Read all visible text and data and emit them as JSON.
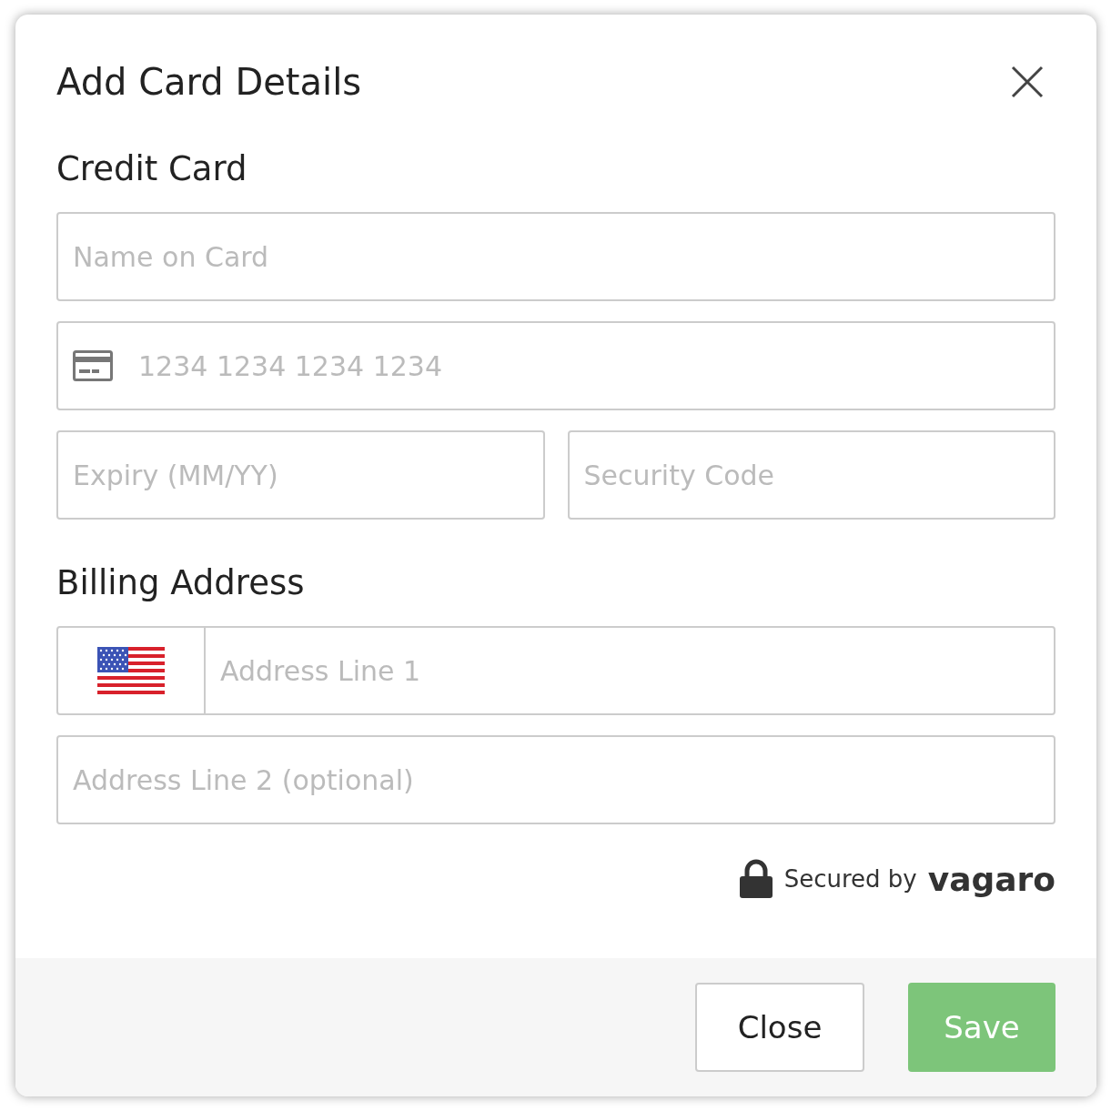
{
  "dialog": {
    "title": "Add Card Details"
  },
  "sections": [
    {
      "heading": "Credit Card",
      "rows": [
        [
          {
            "kind": "text",
            "placeholder": "Name on Card"
          }
        ],
        [
          {
            "kind": "card",
            "placeholder": "1234 1234 1234 1234"
          }
        ],
        [
          {
            "kind": "text",
            "placeholder": "Expiry (MM/YY)"
          },
          {
            "kind": "text",
            "placeholder": "Security Code"
          }
        ]
      ]
    },
    {
      "heading": "Billing Address",
      "rows": [
        [
          {
            "kind": "country",
            "placeholder": "Address Line 1"
          }
        ],
        [
          {
            "kind": "text",
            "placeholder": "Address Line 2 (optional)"
          }
        ]
      ]
    }
  ],
  "security": {
    "text": "Secured by",
    "brand": "vagaro"
  },
  "buttons": [
    {
      "label": "Close",
      "kind": "secondary"
    },
    {
      "label": "Save",
      "kind": "primary"
    }
  ]
}
